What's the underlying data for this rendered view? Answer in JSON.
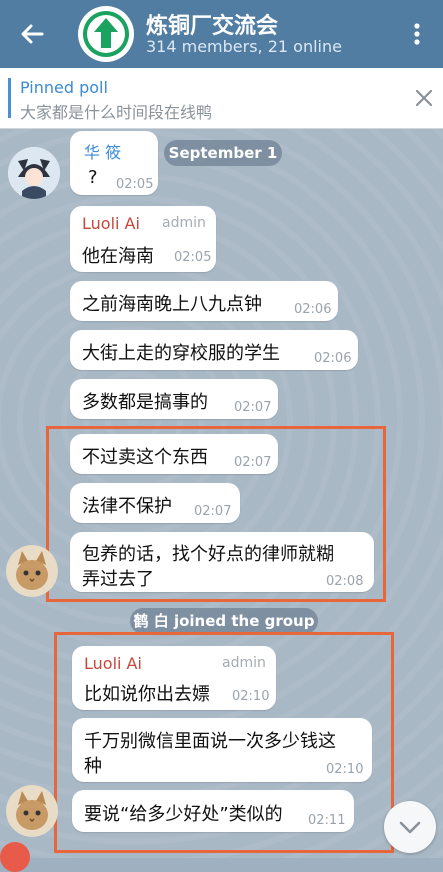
{
  "header": {
    "title": "炼铜厂交流会",
    "subtitle": "314 members, 21 online"
  },
  "pinned": {
    "label": "Pinned poll",
    "text": "大家都是什么时间段在线鸭"
  },
  "date_badge": "September 1",
  "join_notice": "鹤 白 joined the group",
  "messages": [
    {
      "sender": "华 筱",
      "text": "?",
      "time": "02:05"
    },
    {
      "sender": "Luoli Ai",
      "role": "admin",
      "text": "他在海南",
      "time": "02:05"
    },
    {
      "text": "之前海南晚上八九点钟",
      "time": "02:06"
    },
    {
      "text": "大街上走的穿校服的学生",
      "time": "02:06"
    },
    {
      "text": "多数都是搞事的",
      "time": "02:07"
    },
    {
      "text": "不过卖这个东西",
      "time": "02:07"
    },
    {
      "text": "法律不保护",
      "time": "02:07"
    },
    {
      "text1": "包养的话，找个好点的律师就糊",
      "text2": "弄过去了",
      "time": "02:08"
    },
    {
      "sender": "Luoli Ai",
      "role": "admin",
      "text": "比如说你出去嫖",
      "time": "02:10"
    },
    {
      "text1": "千万别微信里面说一次多少钱这",
      "text2": "种",
      "time": "02:10"
    },
    {
      "text": "要说“给多少好处”类似的",
      "time": "02:11"
    }
  ],
  "colors": {
    "header": "#517da2",
    "highlight": "#e8663c",
    "admin_name": "#c7473a"
  },
  "icons": [
    "back-arrow-icon",
    "group-logo-icon",
    "more-vert-icon",
    "close-icon",
    "chevron-down-icon"
  ]
}
